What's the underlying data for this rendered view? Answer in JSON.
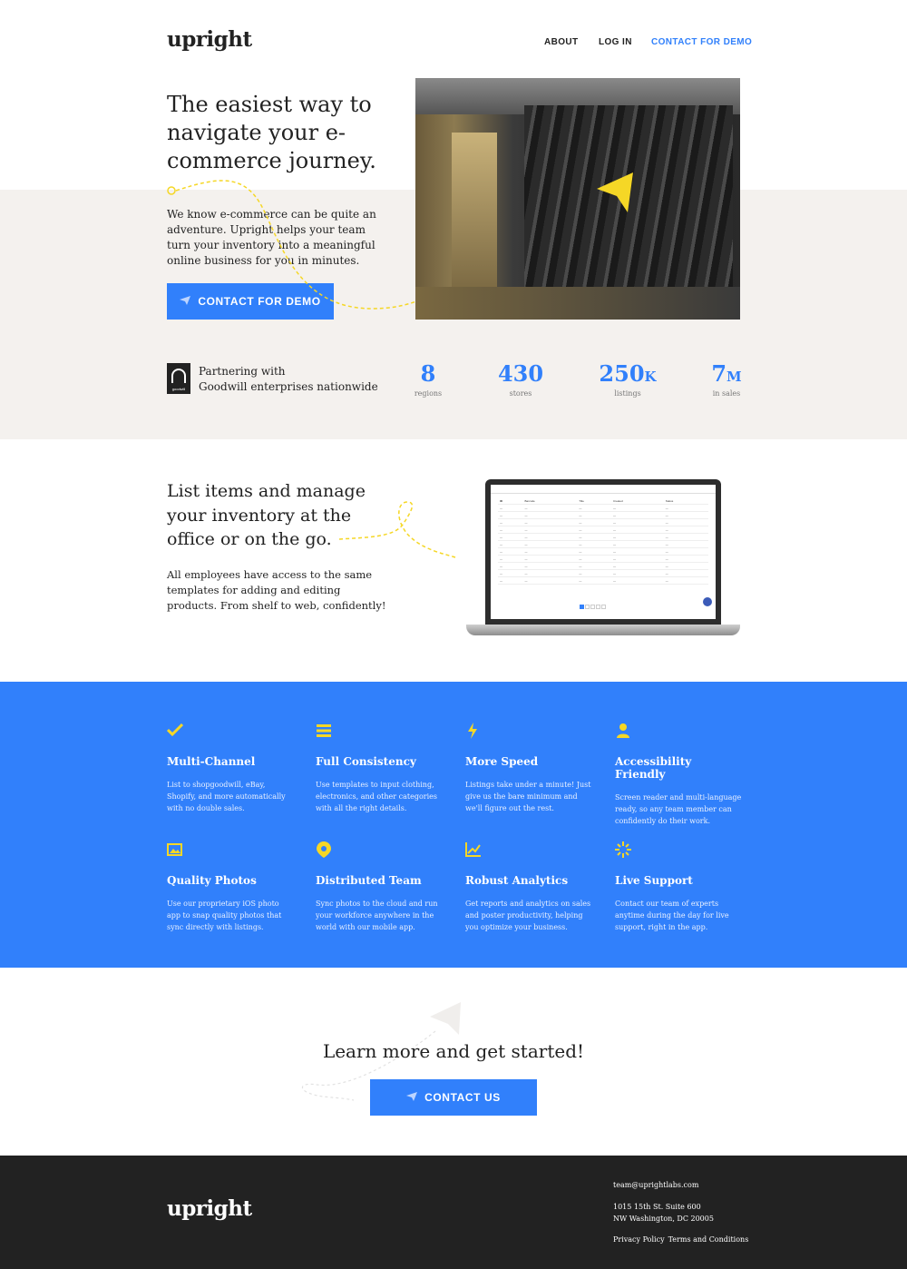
{
  "header": {
    "logo": "upright",
    "nav": {
      "about": "ABOUT",
      "login": "LOG IN",
      "contact": "CONTACT FOR DEMO"
    }
  },
  "hero": {
    "title": "The easiest way to navigate your e-commerce journey.",
    "body": "We know e-commerce can be quite an adventure. Upright helps your team turn your inventory into a meaningful online business for you in minutes.",
    "cta": "CONTACT FOR DEMO"
  },
  "partner": {
    "line1": "Partnering with",
    "line2": "Goodwill enterprises nationwide",
    "logo_text": "goodwill"
  },
  "stats": [
    {
      "num": "8",
      "suffix": "",
      "label": "regions"
    },
    {
      "num": "430",
      "suffix": "",
      "label": "stores"
    },
    {
      "num": "250",
      "suffix": "K",
      "label": "listings"
    },
    {
      "num": "7",
      "suffix": "M",
      "label": "in sales"
    }
  ],
  "inventory": {
    "title": "List items and manage your inventory at the office or on the go.",
    "body": "All employees have access to the same templates for adding and editing products. From shelf to web, confidently!"
  },
  "features": [
    {
      "icon": "checkmark-icon",
      "title": "Multi-Channel",
      "text": "List to shopgoodwill, eBay, Shopify, and more automatically with no double sales."
    },
    {
      "icon": "list-icon",
      "title": "Full Consistency",
      "text": "Use templates to input clothing, electronics, and other categories with all the right details."
    },
    {
      "icon": "lightning-icon",
      "title": "More Speed",
      "text": "Listings take under a minute! Just give us the bare minimum and we'll figure out the rest."
    },
    {
      "icon": "person-icon",
      "title": "Accessibility Friendly",
      "text": "Screen reader and multi-language ready, so any team member can confidently do their work."
    },
    {
      "icon": "photo-icon",
      "title": "Quality Photos",
      "text": "Use our proprietary iOS photo app to snap quality photos that sync directly with listings."
    },
    {
      "icon": "map-pin-icon",
      "title": "Distributed Team",
      "text": "Sync photos to the cloud and run your workforce anywhere in the world with our mobile app."
    },
    {
      "icon": "chart-icon",
      "title": "Robust Analytics",
      "text": "Get reports and analytics on sales and poster productivity, helping you optimize your business."
    },
    {
      "icon": "sparkle-icon",
      "title": "Live Support",
      "text": "Contact our team of experts anytime during the day for live support, right in the app."
    }
  ],
  "cta": {
    "title": "Learn more and get started!",
    "button": "CONTACT US"
  },
  "footer": {
    "logo": "upright",
    "email": "team@uprightlabs.com",
    "address1": "1015 15th St. Suite 600",
    "address2": "NW Washington, DC 20005",
    "privacy": "Privacy Policy",
    "terms": "Terms and Conditions"
  },
  "colors": {
    "blue": "#3180fb",
    "yellow": "#f5d726",
    "beige": "#f4f1ee",
    "dark": "#222222"
  }
}
